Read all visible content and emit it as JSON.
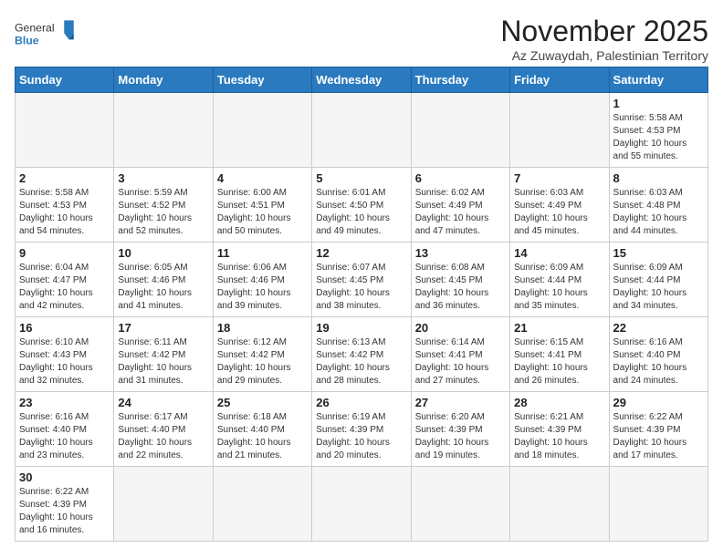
{
  "header": {
    "logo_general": "General",
    "logo_blue": "Blue",
    "month_title": "November 2025",
    "location": "Az Zuwaydah, Palestinian Territory"
  },
  "weekdays": [
    "Sunday",
    "Monday",
    "Tuesday",
    "Wednesday",
    "Thursday",
    "Friday",
    "Saturday"
  ],
  "weeks": [
    [
      {
        "day": "",
        "info": ""
      },
      {
        "day": "",
        "info": ""
      },
      {
        "day": "",
        "info": ""
      },
      {
        "day": "",
        "info": ""
      },
      {
        "day": "",
        "info": ""
      },
      {
        "day": "",
        "info": ""
      },
      {
        "day": "1",
        "info": "Sunrise: 5:58 AM\nSunset: 4:53 PM\nDaylight: 10 hours\nand 55 minutes."
      }
    ],
    [
      {
        "day": "2",
        "info": "Sunrise: 5:58 AM\nSunset: 4:53 PM\nDaylight: 10 hours\nand 54 minutes."
      },
      {
        "day": "3",
        "info": "Sunrise: 5:59 AM\nSunset: 4:52 PM\nDaylight: 10 hours\nand 52 minutes."
      },
      {
        "day": "4",
        "info": "Sunrise: 6:00 AM\nSunset: 4:51 PM\nDaylight: 10 hours\nand 50 minutes."
      },
      {
        "day": "5",
        "info": "Sunrise: 6:01 AM\nSunset: 4:50 PM\nDaylight: 10 hours\nand 49 minutes."
      },
      {
        "day": "6",
        "info": "Sunrise: 6:02 AM\nSunset: 4:49 PM\nDaylight: 10 hours\nand 47 minutes."
      },
      {
        "day": "7",
        "info": "Sunrise: 6:03 AM\nSunset: 4:49 PM\nDaylight: 10 hours\nand 45 minutes."
      },
      {
        "day": "8",
        "info": "Sunrise: 6:03 AM\nSunset: 4:48 PM\nDaylight: 10 hours\nand 44 minutes."
      }
    ],
    [
      {
        "day": "9",
        "info": "Sunrise: 6:04 AM\nSunset: 4:47 PM\nDaylight: 10 hours\nand 42 minutes."
      },
      {
        "day": "10",
        "info": "Sunrise: 6:05 AM\nSunset: 4:46 PM\nDaylight: 10 hours\nand 41 minutes."
      },
      {
        "day": "11",
        "info": "Sunrise: 6:06 AM\nSunset: 4:46 PM\nDaylight: 10 hours\nand 39 minutes."
      },
      {
        "day": "12",
        "info": "Sunrise: 6:07 AM\nSunset: 4:45 PM\nDaylight: 10 hours\nand 38 minutes."
      },
      {
        "day": "13",
        "info": "Sunrise: 6:08 AM\nSunset: 4:45 PM\nDaylight: 10 hours\nand 36 minutes."
      },
      {
        "day": "14",
        "info": "Sunrise: 6:09 AM\nSunset: 4:44 PM\nDaylight: 10 hours\nand 35 minutes."
      },
      {
        "day": "15",
        "info": "Sunrise: 6:09 AM\nSunset: 4:44 PM\nDaylight: 10 hours\nand 34 minutes."
      }
    ],
    [
      {
        "day": "16",
        "info": "Sunrise: 6:10 AM\nSunset: 4:43 PM\nDaylight: 10 hours\nand 32 minutes."
      },
      {
        "day": "17",
        "info": "Sunrise: 6:11 AM\nSunset: 4:42 PM\nDaylight: 10 hours\nand 31 minutes."
      },
      {
        "day": "18",
        "info": "Sunrise: 6:12 AM\nSunset: 4:42 PM\nDaylight: 10 hours\nand 29 minutes."
      },
      {
        "day": "19",
        "info": "Sunrise: 6:13 AM\nSunset: 4:42 PM\nDaylight: 10 hours\nand 28 minutes."
      },
      {
        "day": "20",
        "info": "Sunrise: 6:14 AM\nSunset: 4:41 PM\nDaylight: 10 hours\nand 27 minutes."
      },
      {
        "day": "21",
        "info": "Sunrise: 6:15 AM\nSunset: 4:41 PM\nDaylight: 10 hours\nand 26 minutes."
      },
      {
        "day": "22",
        "info": "Sunrise: 6:16 AM\nSunset: 4:40 PM\nDaylight: 10 hours\nand 24 minutes."
      }
    ],
    [
      {
        "day": "23",
        "info": "Sunrise: 6:16 AM\nSunset: 4:40 PM\nDaylight: 10 hours\nand 23 minutes."
      },
      {
        "day": "24",
        "info": "Sunrise: 6:17 AM\nSunset: 4:40 PM\nDaylight: 10 hours\nand 22 minutes."
      },
      {
        "day": "25",
        "info": "Sunrise: 6:18 AM\nSunset: 4:40 PM\nDaylight: 10 hours\nand 21 minutes."
      },
      {
        "day": "26",
        "info": "Sunrise: 6:19 AM\nSunset: 4:39 PM\nDaylight: 10 hours\nand 20 minutes."
      },
      {
        "day": "27",
        "info": "Sunrise: 6:20 AM\nSunset: 4:39 PM\nDaylight: 10 hours\nand 19 minutes."
      },
      {
        "day": "28",
        "info": "Sunrise: 6:21 AM\nSunset: 4:39 PM\nDaylight: 10 hours\nand 18 minutes."
      },
      {
        "day": "29",
        "info": "Sunrise: 6:22 AM\nSunset: 4:39 PM\nDaylight: 10 hours\nand 17 minutes."
      }
    ],
    [
      {
        "day": "30",
        "info": "Sunrise: 6:22 AM\nSunset: 4:39 PM\nDaylight: 10 hours\nand 16 minutes."
      },
      {
        "day": "",
        "info": ""
      },
      {
        "day": "",
        "info": ""
      },
      {
        "day": "",
        "info": ""
      },
      {
        "day": "",
        "info": ""
      },
      {
        "day": "",
        "info": ""
      },
      {
        "day": "",
        "info": ""
      }
    ]
  ]
}
